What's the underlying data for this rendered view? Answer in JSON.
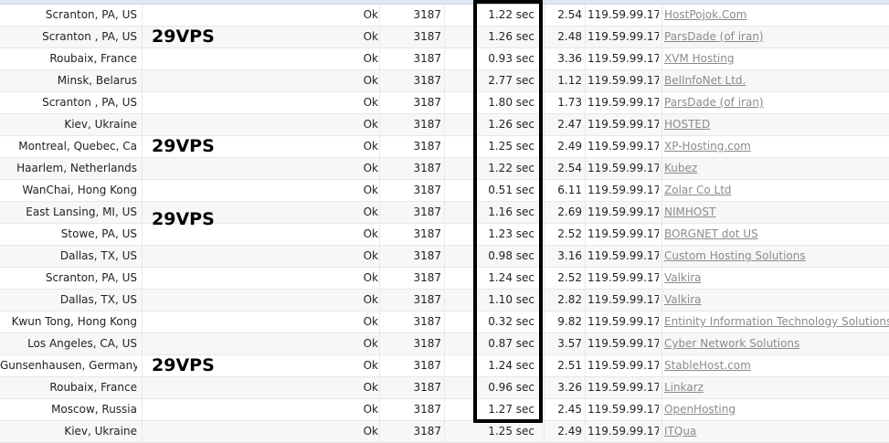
{
  "annotations": [
    "29VPS",
    "29VPS",
    "29VPS",
    "29VPS"
  ],
  "rows": [
    {
      "location": "Scranton, PA, US",
      "status": "Ok",
      "port": "3187",
      "time": "1.22 sec",
      "speed": "2.54",
      "ip": "119.59.99.17",
      "host": "HostPojok.Com"
    },
    {
      "location": "Scranton , PA, US",
      "status": "Ok",
      "port": "3187",
      "time": "1.26 sec",
      "speed": "2.48",
      "ip": "119.59.99.17",
      "host": "ParsDade (of iran)"
    },
    {
      "location": "Roubaix, France",
      "status": "Ok",
      "port": "3187",
      "time": "0.93 sec",
      "speed": "3.36",
      "ip": "119.59.99.17",
      "host": "XVM Hosting"
    },
    {
      "location": "Minsk, Belarus",
      "status": "Ok",
      "port": "3187",
      "time": "2.77 sec",
      "speed": "1.12",
      "ip": "119.59.99.17",
      "host": "BelInfoNet Ltd."
    },
    {
      "location": "Scranton , PA, US",
      "status": "Ok",
      "port": "3187",
      "time": "1.80 sec",
      "speed": "1.73",
      "ip": "119.59.99.17",
      "host": "ParsDade (of iran)"
    },
    {
      "location": "Kiev, Ukraine",
      "status": "Ok",
      "port": "3187",
      "time": "1.26 sec",
      "speed": "2.47",
      "ip": "119.59.99.17",
      "host": "HOSTED"
    },
    {
      "location": "Montreal, Quebec, Ca",
      "status": "Ok",
      "port": "3187",
      "time": "1.25 sec",
      "speed": "2.49",
      "ip": "119.59.99.17",
      "host": "XP-Hosting.com"
    },
    {
      "location": "Haarlem, Netherlands",
      "status": "Ok",
      "port": "3187",
      "time": "1.22 sec",
      "speed": "2.54",
      "ip": "119.59.99.17",
      "host": "Kubez"
    },
    {
      "location": "WanChai, Hong Kong",
      "status": "Ok",
      "port": "3187",
      "time": "0.51 sec",
      "speed": "6.11",
      "ip": "119.59.99.17",
      "host": "Zolar Co Ltd"
    },
    {
      "location": "East Lansing, MI, US",
      "status": "Ok",
      "port": "3187",
      "time": "1.16 sec",
      "speed": "2.69",
      "ip": "119.59.99.17",
      "host": "NIMHOST"
    },
    {
      "location": "Stowe, PA, US",
      "status": "Ok",
      "port": "3187",
      "time": "1.23 sec",
      "speed": "2.52",
      "ip": "119.59.99.17",
      "host": "BORGNET dot US"
    },
    {
      "location": "Dallas, TX, US",
      "status": "Ok",
      "port": "3187",
      "time": "0.98 sec",
      "speed": "3.16",
      "ip": "119.59.99.17",
      "host": "Custom Hosting Solutions"
    },
    {
      "location": "Scranton, PA, US",
      "status": "Ok",
      "port": "3187",
      "time": "1.24 sec",
      "speed": "2.52",
      "ip": "119.59.99.17",
      "host": "Valkira"
    },
    {
      "location": "Dallas, TX, US",
      "status": "Ok",
      "port": "3187",
      "time": "1.10 sec",
      "speed": "2.82",
      "ip": "119.59.99.17",
      "host": "Valkira"
    },
    {
      "location": "Kwun Tong, Hong Kong",
      "status": "Ok",
      "port": "3187",
      "time": "0.32 sec",
      "speed": "9.82",
      "ip": "119.59.99.17",
      "host": "Entinity Information Technology Solutions"
    },
    {
      "location": "Los Angeles, CA, US",
      "status": "Ok",
      "port": "3187",
      "time": "0.87 sec",
      "speed": "3.57",
      "ip": "119.59.99.17",
      "host": "Cyber Network Solutions"
    },
    {
      "location": "Gunsenhausen, Germany",
      "status": "Ok",
      "port": "3187",
      "time": "1.24 sec",
      "speed": "2.51",
      "ip": "119.59.99.17",
      "host": "StableHost.com"
    },
    {
      "location": "Roubaix, France",
      "status": "Ok",
      "port": "3187",
      "time": "0.96 sec",
      "speed": "3.26",
      "ip": "119.59.99.17",
      "host": "Linkarz"
    },
    {
      "location": "Moscow, Russia",
      "status": "Ok",
      "port": "3187",
      "time": "1.27 sec",
      "speed": "2.45",
      "ip": "119.59.99.17",
      "host": "OpenHosting"
    },
    {
      "location": "Kiev, Ukraine",
      "status": "Ok",
      "port": "3187",
      "time": "1.25 sec",
      "speed": "2.49",
      "ip": "119.59.99.17",
      "host": "ITQua"
    }
  ]
}
